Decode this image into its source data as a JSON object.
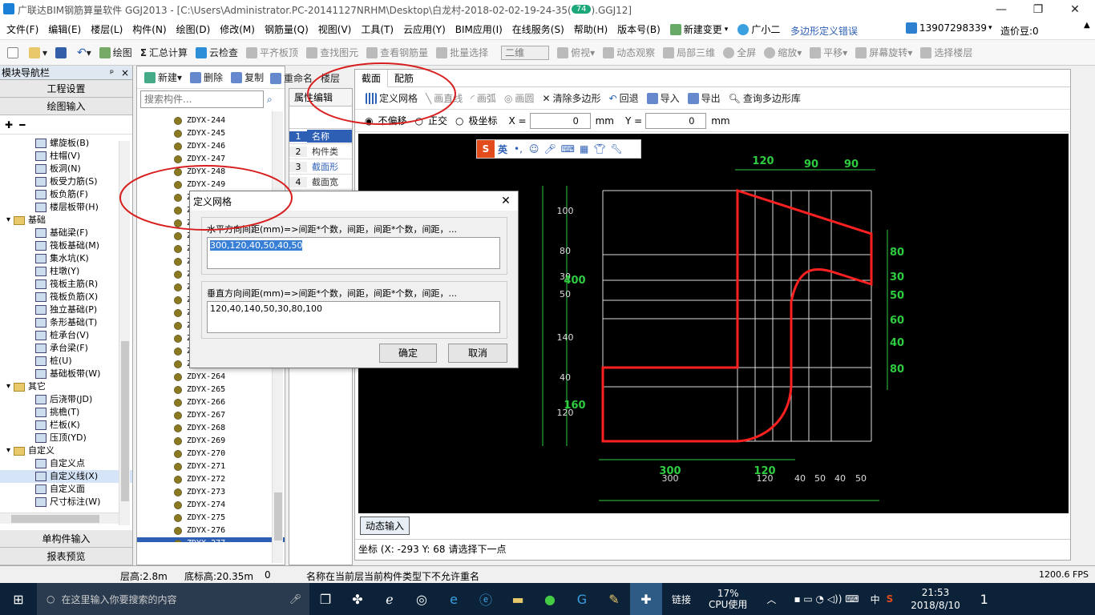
{
  "window": {
    "title": "广联达BIM钢筋算量软件 GGJ2013 - [C:\\Users\\Administrator.PC-20141127NRHM\\Desktop\\白龙村-2018-02-02-19-24-35(",
    "title_tail": ").GGJ12]",
    "badge": "74"
  },
  "menu": {
    "items": [
      "文件(F)",
      "编辑(E)",
      "楼层(L)",
      "构件(N)",
      "绘图(D)",
      "修改(M)",
      "钢筋量(Q)",
      "视图(V)",
      "工具(T)",
      "云应用(Y)",
      "BIM应用(I)",
      "在线服务(S)",
      "帮助(H)",
      "版本号(B)",
      "新建变更",
      "广小二"
    ],
    "error_link": "多边形定义错误",
    "phone": "13907298339",
    "beans": "造价豆:0"
  },
  "toolbar": {
    "draw": "绘图",
    "sum": "汇总计算",
    "cloud_check": "云检查",
    "flat_top": "平齐板顶",
    "find_elem": "查找图元",
    "view_rebar": "查看钢筋量",
    "batch_select": "批量选择",
    "view_mode": "二维",
    "top_view": "俯视",
    "dynamic": "动态观察",
    "local3d": "局部三维",
    "fullscreen": "全屏",
    "zoom": "缩放",
    "pan": "平移",
    "rotate": "屏幕旋转",
    "select_floor": "选择楼层"
  },
  "leftnav": {
    "header": "模块导航栏",
    "pin": "ᵖ",
    "close": "×",
    "project_settings": "工程设置",
    "draw_input": "绘图输入",
    "items": [
      {
        "label": "螺旋板(B)",
        "indent": 2
      },
      {
        "label": "柱帽(V)",
        "indent": 2
      },
      {
        "label": "板洞(N)",
        "indent": 2
      },
      {
        "label": "板受力筋(S)",
        "indent": 2
      },
      {
        "label": "板负筋(F)",
        "indent": 2
      },
      {
        "label": "楼层板带(H)",
        "indent": 2
      },
      {
        "label": "基础",
        "indent": 1,
        "folder": true
      },
      {
        "label": "基础梁(F)",
        "indent": 2
      },
      {
        "label": "筏板基础(M)",
        "indent": 2
      },
      {
        "label": "集水坑(K)",
        "indent": 2
      },
      {
        "label": "柱墩(Y)",
        "indent": 2
      },
      {
        "label": "筏板主筋(R)",
        "indent": 2
      },
      {
        "label": "筏板负筋(X)",
        "indent": 2
      },
      {
        "label": "独立基础(P)",
        "indent": 2
      },
      {
        "label": "条形基础(T)",
        "indent": 2
      },
      {
        "label": "桩承台(V)",
        "indent": 2
      },
      {
        "label": "承台梁(F)",
        "indent": 2
      },
      {
        "label": "桩(U)",
        "indent": 2
      },
      {
        "label": "基础板带(W)",
        "indent": 2
      },
      {
        "label": "其它",
        "indent": 1,
        "folder": true
      },
      {
        "label": "后浇带(JD)",
        "indent": 2
      },
      {
        "label": "挑檐(T)",
        "indent": 2
      },
      {
        "label": "栏板(K)",
        "indent": 2
      },
      {
        "label": "压顶(YD)",
        "indent": 2
      },
      {
        "label": "自定义",
        "indent": 1,
        "folder": true
      },
      {
        "label": "自定义点",
        "indent": 2
      },
      {
        "label": "自定义线(X)",
        "indent": 2,
        "selected": true
      },
      {
        "label": "自定义面",
        "indent": 2
      },
      {
        "label": "尺寸标注(W)",
        "indent": 2
      }
    ],
    "single_input": "单构件输入",
    "report_preview": "报表预览"
  },
  "complist": {
    "new_btn": "新建",
    "delete_btn": "删除",
    "copy_btn": "复制",
    "rename_btn": "重命名",
    "floor_btn": "楼层",
    "search_placeholder": "搜索构件...",
    "rows": [
      "ZDYX-244",
      "ZDYX-245",
      "ZDYX-246",
      "ZDYX-247",
      "ZDYX-248",
      "ZDYX-249",
      "ZDYX-250",
      "ZDYX-251",
      "ZDYX-252",
      "ZDYX-253",
      "ZDYX-254",
      "ZDYX-255",
      "ZDYX-256",
      "ZDYX-257",
      "ZDYX-258",
      "ZDYX-259",
      "ZDYX-260",
      "ZDYX-261",
      "ZDYX-262",
      "ZDYX-263",
      "ZDYX-264",
      "ZDYX-265",
      "ZDYX-266",
      "ZDYX-267",
      "ZDYX-268",
      "ZDYX-269",
      "ZDYX-270",
      "ZDYX-271",
      "ZDYX-272",
      "ZDYX-273",
      "ZDYX-274",
      "ZDYX-275",
      "ZDYX-276",
      "ZDYX-277"
    ]
  },
  "props": {
    "tab": "属性编辑",
    "rows": [
      {
        "n": "1",
        "v": "名称"
      },
      {
        "n": "2",
        "v": "构件类"
      },
      {
        "n": "3",
        "v": "截面形"
      },
      {
        "n": "4",
        "v": "截面宽"
      }
    ]
  },
  "section": {
    "tabs": [
      "截面",
      "配筋"
    ],
    "tools": [
      "定义网格",
      "画直线",
      "画弧",
      "画圆",
      "清除多边形",
      "回退",
      "导入",
      "导出",
      "查询多边形库"
    ],
    "options": [
      "不偏移",
      "正交",
      "极坐标"
    ],
    "x_label": "X =",
    "x_value": "0",
    "y_label": "Y =",
    "y_value": "0",
    "unit": "mm",
    "dynamic_input": "动态输入",
    "coord_label": "坐标 (X: -293 Y: 68",
    "prompt": "请选择下一点"
  },
  "canvas": {
    "top_dims": [
      "120",
      "90",
      "90"
    ],
    "left_dims": [
      "100",
      "80",
      "30",
      "50",
      "140",
      "40",
      "120"
    ],
    "left_big": [
      "400",
      "160"
    ],
    "right_dims": [
      "80",
      "30",
      "50",
      "60",
      "40",
      "80"
    ],
    "bottom_big": [
      "300",
      "120"
    ],
    "bottom_small": [
      "300",
      "120",
      "40",
      "50",
      "40",
      "50"
    ]
  },
  "dialog": {
    "title": "定义网格",
    "h_label": "水平方向间距(mm)=>间距*个数，间距，间距*个数，间距，...",
    "h_value": "300,120,40,50,40,50",
    "v_label": "垂直方向间距(mm)=>间距*个数，间距，间距*个数，间距，...",
    "v_value": "120,40,140,50,30,80,100",
    "ok": "确定",
    "cancel": "取消"
  },
  "ime": {
    "lang": "英"
  },
  "status": {
    "floor_height": "层高:2.8m",
    "base_height": "底标高:20.35m",
    "count": "0",
    "message": "名称在当前层当前构件类型下不允许重名",
    "fps": "1200.6 FPS"
  },
  "taskbar": {
    "search": "在这里输入你要搜索的内容",
    "link": "链接",
    "cpu": "17%",
    "cpu_label": "CPU使用",
    "lang": "中",
    "time": "21:53",
    "date": "2018/8/10",
    "notif": "1"
  },
  "colors": {
    "accent": "#2d5fb5",
    "canvas": "#000000",
    "dim": "#2ecc40",
    "shape": "#ff2020",
    "annot": "#d81f1f"
  }
}
